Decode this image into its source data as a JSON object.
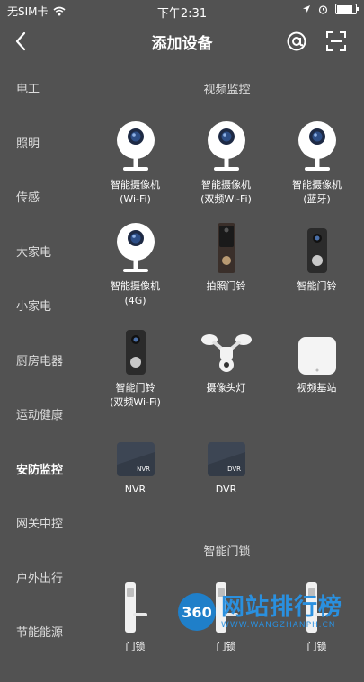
{
  "status_bar": {
    "carrier": "无SIM卡",
    "time": "下午2:31",
    "battery_level": 0.9
  },
  "header": {
    "title": "添加设备"
  },
  "sidebar": {
    "items": [
      {
        "label": "电工"
      },
      {
        "label": "照明"
      },
      {
        "label": "传感"
      },
      {
        "label": "大家电"
      },
      {
        "label": "小家电"
      },
      {
        "label": "厨房电器"
      },
      {
        "label": "运动健康"
      },
      {
        "label": "安防监控",
        "active": true
      },
      {
        "label": "网关中控"
      },
      {
        "label": "户外出行"
      },
      {
        "label": "节能能源"
      }
    ]
  },
  "sections": [
    {
      "title": "视频监控",
      "devices": [
        {
          "icon": "camera-icon",
          "line1": "智能摄像机",
          "line2": "(Wi-Fi)"
        },
        {
          "icon": "camera-icon",
          "line1": "智能摄像机",
          "line2": "(双频Wi-Fi)"
        },
        {
          "icon": "camera-icon",
          "line1": "智能摄像机",
          "line2": "(蓝牙)"
        },
        {
          "icon": "camera-icon",
          "line1": "智能摄像机",
          "line2": "(4G)"
        },
        {
          "icon": "photo-doorbell-icon",
          "line1": "拍照门铃",
          "line2": ""
        },
        {
          "icon": "smart-doorbell-icon",
          "line1": "智能门铃",
          "line2": ""
        },
        {
          "icon": "smart-doorbell-icon",
          "line1": "智能门铃",
          "line2": "(双频Wi-Fi)"
        },
        {
          "icon": "camera-light-icon",
          "line1": "摄像头灯",
          "line2": ""
        },
        {
          "icon": "video-base-station-icon",
          "line1": "视频基站",
          "line2": ""
        },
        {
          "icon": "nvr-icon",
          "icon_text": "NVR",
          "line1": "NVR",
          "line2": ""
        },
        {
          "icon": "dvr-icon",
          "icon_text": "DVR",
          "line1": "DVR",
          "line2": ""
        }
      ]
    },
    {
      "title": "智能门锁",
      "devices": [
        {
          "icon": "door-lock-icon",
          "line1": "门锁",
          "line2": ""
        },
        {
          "icon": "door-lock-icon",
          "line1": "门锁",
          "line2": ""
        },
        {
          "icon": "door-lock-icon",
          "line1": "门锁",
          "line2": ""
        }
      ]
    }
  ],
  "watermark": {
    "logo_text": "360",
    "title": "网站排行榜",
    "subtitle": "WWW.WANGZHANPH.CN"
  },
  "colors": {
    "background": "#525252",
    "camera_body": "#ffffff",
    "camera_lens": "#2d4e86",
    "doorbell": "#2b2b2b",
    "watermark": "#2a90df"
  }
}
